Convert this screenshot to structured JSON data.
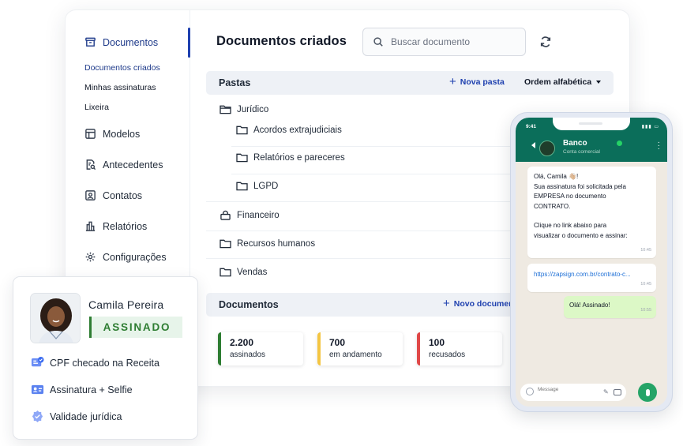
{
  "sidebar": {
    "items": [
      {
        "label": "Documentos",
        "icon": "archive-icon"
      },
      {
        "label": "Modelos",
        "icon": "template-icon"
      },
      {
        "label": "Antecedentes",
        "icon": "search-doc-icon"
      },
      {
        "label": "Contatos",
        "icon": "contact-icon"
      },
      {
        "label": "Relatórios",
        "icon": "building-icon"
      },
      {
        "label": "Configurações",
        "icon": "gear-icon"
      }
    ],
    "sub_items": [
      "Documentos criados",
      "Minhas assinaturas",
      "Lixeira"
    ]
  },
  "main": {
    "title": "Documentos criados",
    "search_placeholder": "Buscar documento",
    "folders_bar": {
      "title": "Pastas",
      "new_label": "Nova pasta",
      "sort_label": "Ordem alfabética"
    },
    "folders": {
      "juridico": "Jurídico",
      "acordos": "Acordos extrajudiciais",
      "relatorios": "Relatórios e pareceres",
      "lgpd": "LGPD",
      "financeiro": "Financeiro",
      "rh": "Recursos humanos",
      "vendas": "Vendas"
    },
    "docs_bar": {
      "title": "Documentos",
      "new_label": "Novo documento"
    },
    "stats": [
      {
        "value": "2.200",
        "label": "assinados",
        "color": "#2e7d32"
      },
      {
        "value": "700",
        "label": "em andamento",
        "color": "#f4c542"
      },
      {
        "value": "100",
        "label": "recusados",
        "color": "#e04848"
      }
    ]
  },
  "signer_card": {
    "name": "Camila Pereira",
    "status": "ASSINADO",
    "checks": [
      {
        "label": "CPF checado na Receita",
        "icon": "id-check-icon"
      },
      {
        "label": "Assinatura + Selfie",
        "icon": "id-card-icon"
      },
      {
        "label": "Validade jurídica",
        "icon": "verified-seal-icon"
      }
    ],
    "accent_color": "#2e7d32"
  },
  "phone": {
    "time": "9:41",
    "contact_name": "Banco",
    "contact_subtitle": "Conta comercial",
    "messages": {
      "m1": {
        "lines": [
          "Olá, Camila 👋🏼!",
          "Sua assinatura foi solicitada pela",
          "EMPRESA no documento",
          "CONTRATO.",
          "",
          "Clique no link abaixo para",
          "visualizar o documento e assinar:"
        ],
        "time": "10:45"
      },
      "m2": {
        "text": "https://zapsign.com.br/contrato-c...",
        "time": "10:45"
      },
      "m3": {
        "text": "Olá! Assinado!",
        "time": "10:55"
      }
    },
    "composer_placeholder": "Message",
    "header_color": "#0b6e5a"
  }
}
